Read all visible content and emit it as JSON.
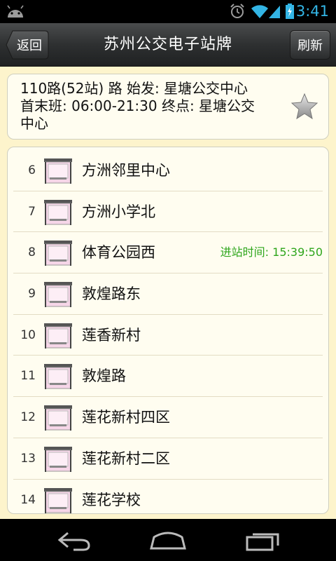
{
  "status_bar": {
    "time": "3:41",
    "icons": [
      "android-icon",
      "alarm-icon",
      "wifi-icon",
      "signal-icon",
      "battery-icon"
    ],
    "accent_color": "#33b5e5"
  },
  "header": {
    "back_label": "返回",
    "title": "苏州公交电子站牌",
    "refresh_label": "刷新"
  },
  "route": {
    "line1": "110路(52站) 路 始发: 星塘公交中心",
    "line2": "首末班: 06:00-21:30 终点: 星塘公交",
    "line3": "中心",
    "favorite_icon": "star-icon"
  },
  "stops": [
    {
      "index": "6",
      "name": "方洲邻里中心",
      "arrival": ""
    },
    {
      "index": "7",
      "name": "方洲小学北",
      "arrival": ""
    },
    {
      "index": "8",
      "name": "体育公园西",
      "arrival": "进站时间: 15:39:50"
    },
    {
      "index": "9",
      "name": "敦煌路东",
      "arrival": ""
    },
    {
      "index": "10",
      "name": "莲香新村",
      "arrival": ""
    },
    {
      "index": "11",
      "name": "敦煌路",
      "arrival": ""
    },
    {
      "index": "12",
      "name": "莲花新村四区",
      "arrival": ""
    },
    {
      "index": "13",
      "name": "莲花新村二区",
      "arrival": ""
    },
    {
      "index": "14",
      "name": "莲花学校",
      "arrival": ""
    }
  ],
  "colors": {
    "background": "#fdf4cc",
    "arrival_text": "#2ea61c"
  },
  "nav_bar": {
    "icons": [
      "back-nav-icon",
      "home-nav-icon",
      "recent-apps-icon"
    ]
  }
}
